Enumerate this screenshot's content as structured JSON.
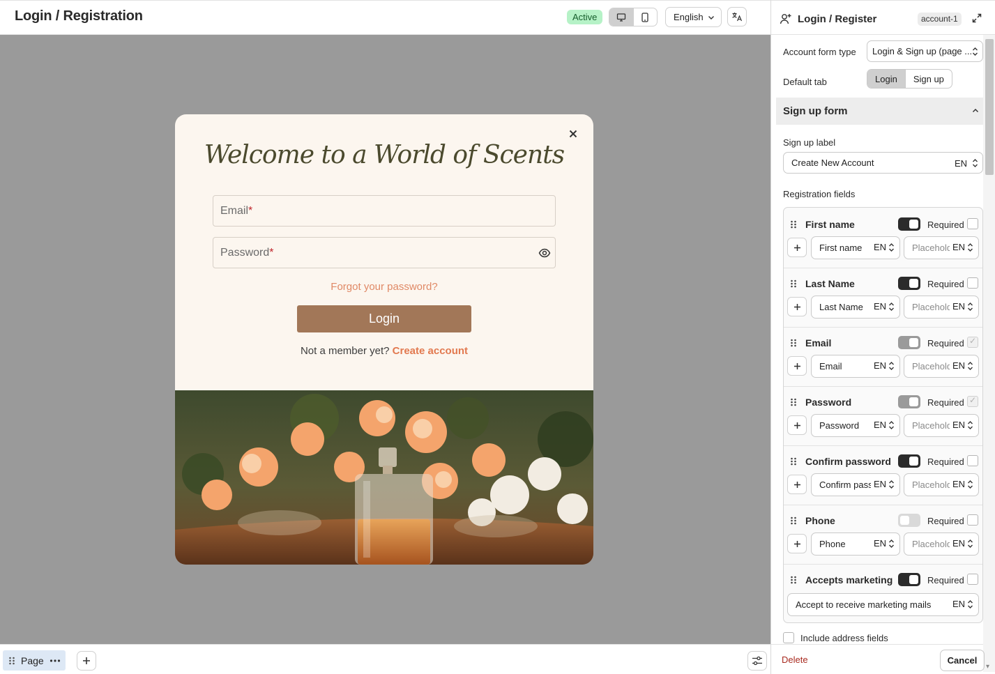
{
  "header": {
    "title": "Login / Registration",
    "status": "Active",
    "language": "English"
  },
  "modal": {
    "heading": "Welcome to a World of Scents",
    "email_placeholder": "Email",
    "password_placeholder": "Password",
    "required_mark": "*",
    "forgot_link": "Forgot your password?",
    "login_button": "Login",
    "member_prompt": "Not a member yet?",
    "create_link": "Create account"
  },
  "footer": {
    "page_tab": "Page"
  },
  "panel": {
    "title": "Login / Register",
    "id": "account-1",
    "form_type_label": "Account form type",
    "form_type_value": "Login & Sign up (page ...",
    "default_tab_label": "Default tab",
    "default_tabs": [
      "Login",
      "Sign up"
    ],
    "section_title": "Sign up form",
    "signup_label_title": "Sign up label",
    "signup_label_value": "Create New Account",
    "lang_code": "EN",
    "registration_title": "Registration fields",
    "required_text": "Required",
    "fields": [
      {
        "name": "First name",
        "label": "First name",
        "placeholder": "Placeholder",
        "toggle": "on",
        "required": "unchecked"
      },
      {
        "name": "Last Name",
        "label": "Last Name",
        "placeholder": "Placeholder",
        "toggle": "on",
        "required": "unchecked"
      },
      {
        "name": "Email",
        "label": "Email",
        "placeholder": "Placeholder",
        "toggle": "locked",
        "required": "checked-disabled"
      },
      {
        "name": "Password",
        "label": "Password",
        "placeholder": "Placeholder",
        "toggle": "locked",
        "required": "checked-disabled"
      },
      {
        "name": "Confirm password",
        "label": "Confirm password",
        "placeholder": "Placeholder",
        "toggle": "on",
        "required": "unchecked"
      },
      {
        "name": "Phone",
        "label": "Phone",
        "placeholder": "Placeholder",
        "toggle": "off",
        "required": "unchecked"
      }
    ],
    "marketing": {
      "name": "Accepts marketing",
      "label": "Accept to receive marketing mails"
    },
    "address_label": "Include address fields",
    "delete_label": "Delete",
    "cancel_label": "Cancel"
  }
}
